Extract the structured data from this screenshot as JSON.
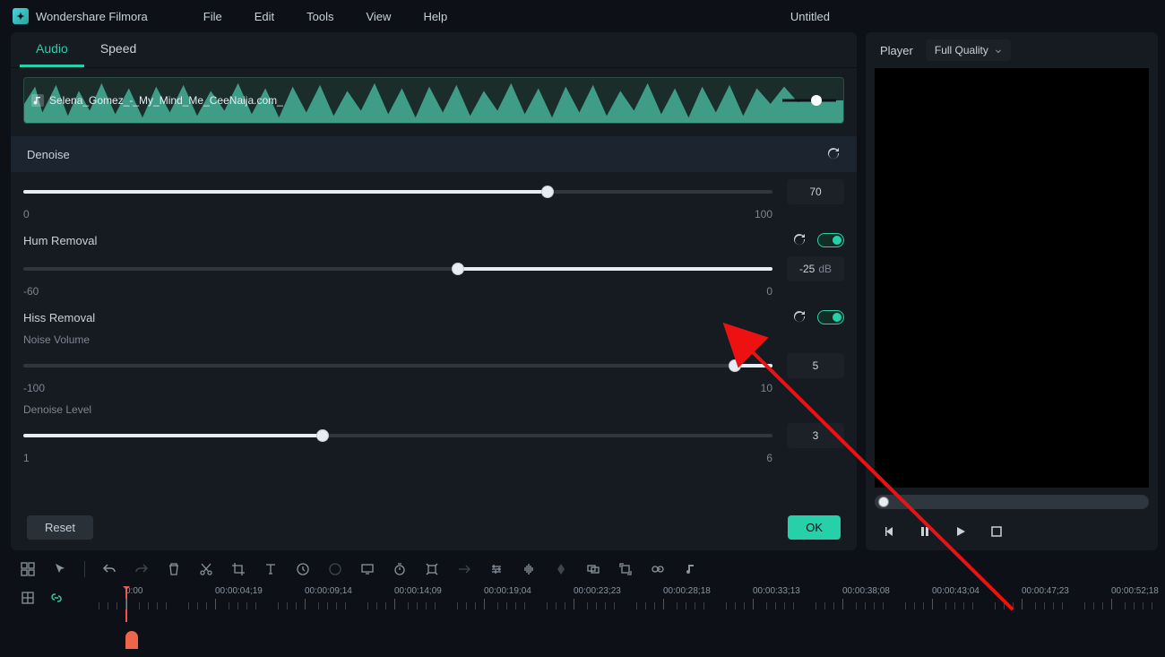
{
  "app": {
    "name": "Wondershare Filmora"
  },
  "menu": [
    "File",
    "Edit",
    "Tools",
    "View",
    "Help"
  ],
  "doc": {
    "title": "Untitled"
  },
  "tabs": {
    "audio": "Audio",
    "speed": "Speed"
  },
  "clip": {
    "filename": "Selena_Gomez_-_My_Mind_Me_CeeNaija.com_"
  },
  "denoise": {
    "label": "Denoise",
    "value": "70",
    "min": "0",
    "max": "100",
    "percent": 70
  },
  "hum": {
    "label": "Hum Removal",
    "value": "-25",
    "min": "-60",
    "max": "0",
    "percent": 58
  },
  "hiss": {
    "label": "Hiss Removal",
    "noise": {
      "label": "Noise Volume",
      "value": "5",
      "min": "-100",
      "max": "10",
      "percent": 95
    },
    "level": {
      "label": "Denoise Level",
      "value": "3",
      "min": "1",
      "max": "6",
      "percent": 40
    }
  },
  "buttons": {
    "reset": "Reset",
    "ok": "OK"
  },
  "player": {
    "label": "Player",
    "quality": "Full Quality"
  },
  "timeline": {
    "marks": [
      "0:00",
      "00:00:04;19",
      "00:00:09;14",
      "00:00:14;09",
      "00:00:19;04",
      "00:00:23;23",
      "00:00:28;18",
      "00:00:33;13",
      "00:00:38;08",
      "00:00:43;04",
      "00:00:47;23",
      "00:00:52;18"
    ]
  }
}
